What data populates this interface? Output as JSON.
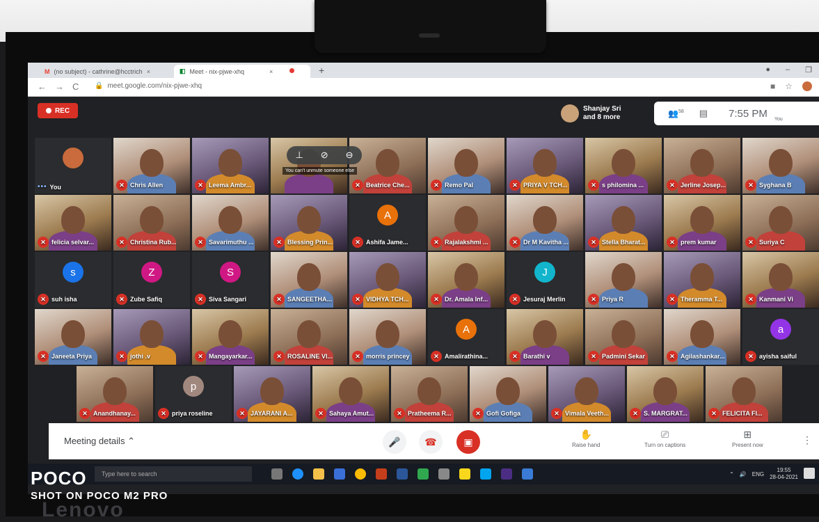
{
  "browser": {
    "tabs": [
      {
        "icon": "M",
        "title": "(no subject) - cathrine@hcctrich",
        "close": "×"
      },
      {
        "icon": "◧",
        "title": "Meet - nix-pjwe-xhq",
        "close": "×"
      }
    ],
    "new_tab": "+",
    "url": "meet.google.com/nix-pjwe-xhq"
  },
  "meet": {
    "rec_label": "REC",
    "pinned_name": "Shanjay Sri",
    "pinned_more": "and 8 more",
    "people_count": "58",
    "time": "7:55 PM",
    "you_label": "You",
    "hover_tooltip": "You can't unmute someone else",
    "participants_rows": [
      [
        "You",
        "Chris Allen",
        "Leema Ambr...",
        "",
        "Beatrice Che...",
        "Remo Pal",
        "PRIYA V TCH...",
        "s philomina ...",
        "Jerline Josep...",
        "Syghana B"
      ],
      [
        "felicia selvar...",
        "Christina Rub...",
        "Savarimuthu ...",
        "Blessing Prin...",
        "Ashifa Jame...",
        "Rajalakshmi ...",
        "Dr M Kavitha ...",
        "Stella Bharat...",
        "prem kumar",
        "Suriya C"
      ],
      [
        "suh isha",
        "Zube Safiq",
        "Siva Sangari",
        "SANGEETHA...",
        "VIDHYA TCH...",
        "Dr. Amala Inf...",
        "Jesuraj Merlin",
        "Priya R",
        "Theramma T...",
        "Kanmani Vi"
      ],
      [
        "Janeeta Priya",
        "jothi .v",
        "Mangayarkar...",
        "ROSALINE VI...",
        "morris princey",
        "Amalirathina...",
        "Barathi v",
        "Padmini Sekar",
        "Agilashankar...",
        "ayisha saiful"
      ],
      [
        "Anandhanay...",
        "priya roseline",
        "JAYARANI A...",
        "Sahaya Amut...",
        "Pratheema R...",
        "Gofi Gofiga",
        "Vimala Veeth...",
        "S. MARGRAT...",
        "FELICITA FI..."
      ]
    ],
    "letters": {
      "Ashifa Jame...": "A",
      "suh isha": "s",
      "Zube Safiq": "Z",
      "Siva Sangari": "S",
      "Jesuraj Merlin": "J",
      "Amalirathina...": "A",
      "ayisha saiful": "a",
      "priya roseline": "p"
    },
    "letter_colors": {
      "A": "#e8710a",
      "s": "#1a73e8",
      "Z": "#d01884",
      "S": "#d01884",
      "J": "#12b5cb",
      "a": "#9334e6",
      "p": "#a1887f"
    },
    "meeting_details": "Meeting details",
    "raise_hand": "Raise hand",
    "captions": "Turn on captions",
    "present": "Present now"
  },
  "taskbar": {
    "search_placeholder": "Type here to search",
    "lang": "ENG",
    "clock_time": "19:55",
    "clock_date": "28-04-2021"
  },
  "watermark": {
    "brand": "POCO",
    "shot": "SHOT ON POCO M2 PRO"
  },
  "monitor_brand": "Lenovo"
}
